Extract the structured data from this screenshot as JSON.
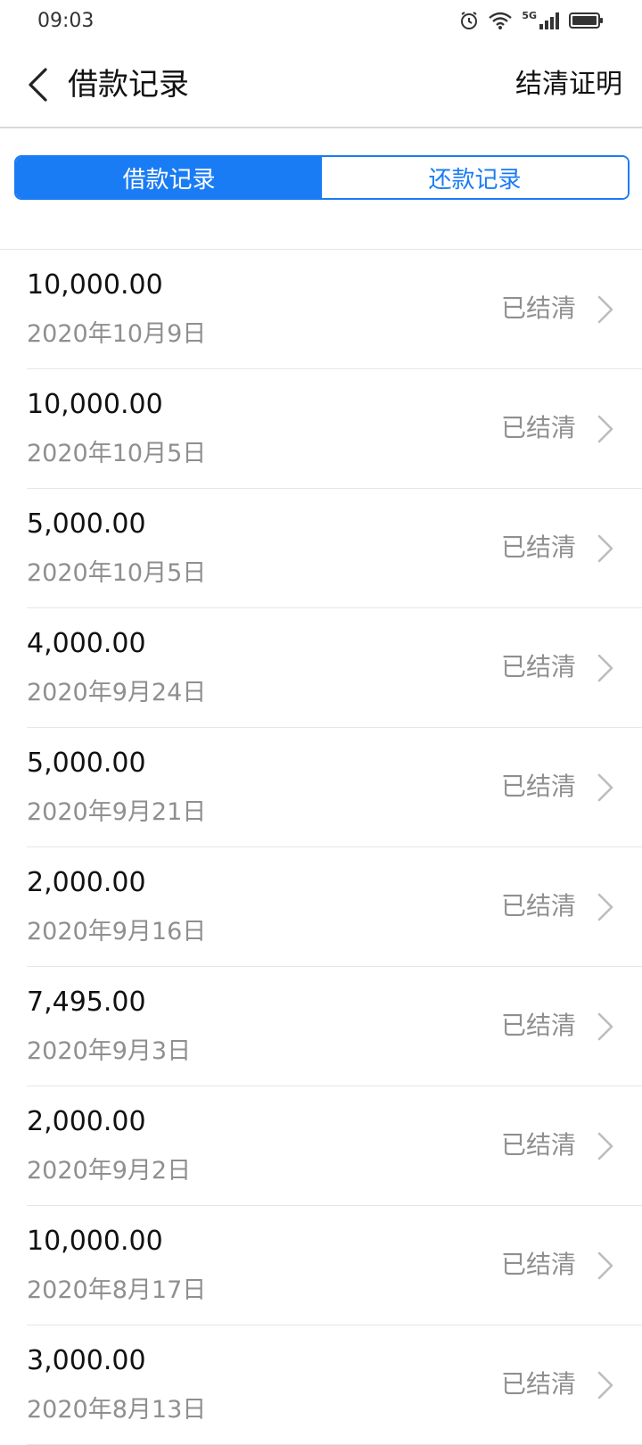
{
  "status_bar": {
    "time": "09:03",
    "network": "5G"
  },
  "header": {
    "title": "借款记录",
    "right_link": "结清证明"
  },
  "tabs": [
    {
      "label": "借款记录",
      "active": true
    },
    {
      "label": "还款记录",
      "active": false
    }
  ],
  "records": [
    {
      "amount": "10,000.00",
      "date": "2020年10月9日",
      "status": "已结清"
    },
    {
      "amount": "10,000.00",
      "date": "2020年10月5日",
      "status": "已结清"
    },
    {
      "amount": "5,000.00",
      "date": "2020年10月5日",
      "status": "已结清"
    },
    {
      "amount": "4,000.00",
      "date": "2020年9月24日",
      "status": "已结清"
    },
    {
      "amount": "5,000.00",
      "date": "2020年9月21日",
      "status": "已结清"
    },
    {
      "amount": "2,000.00",
      "date": "2020年9月16日",
      "status": "已结清"
    },
    {
      "amount": "7,495.00",
      "date": "2020年9月3日",
      "status": "已结清"
    },
    {
      "amount": "2,000.00",
      "date": "2020年9月2日",
      "status": "已结清"
    },
    {
      "amount": "10,000.00",
      "date": "2020年8月17日",
      "status": "已结清"
    },
    {
      "amount": "3,000.00",
      "date": "2020年8月13日",
      "status": "已结清"
    }
  ],
  "colors": {
    "accent": "#1a7cf4",
    "muted_text": "#8f8f8f",
    "divider": "#e6e6e6"
  }
}
